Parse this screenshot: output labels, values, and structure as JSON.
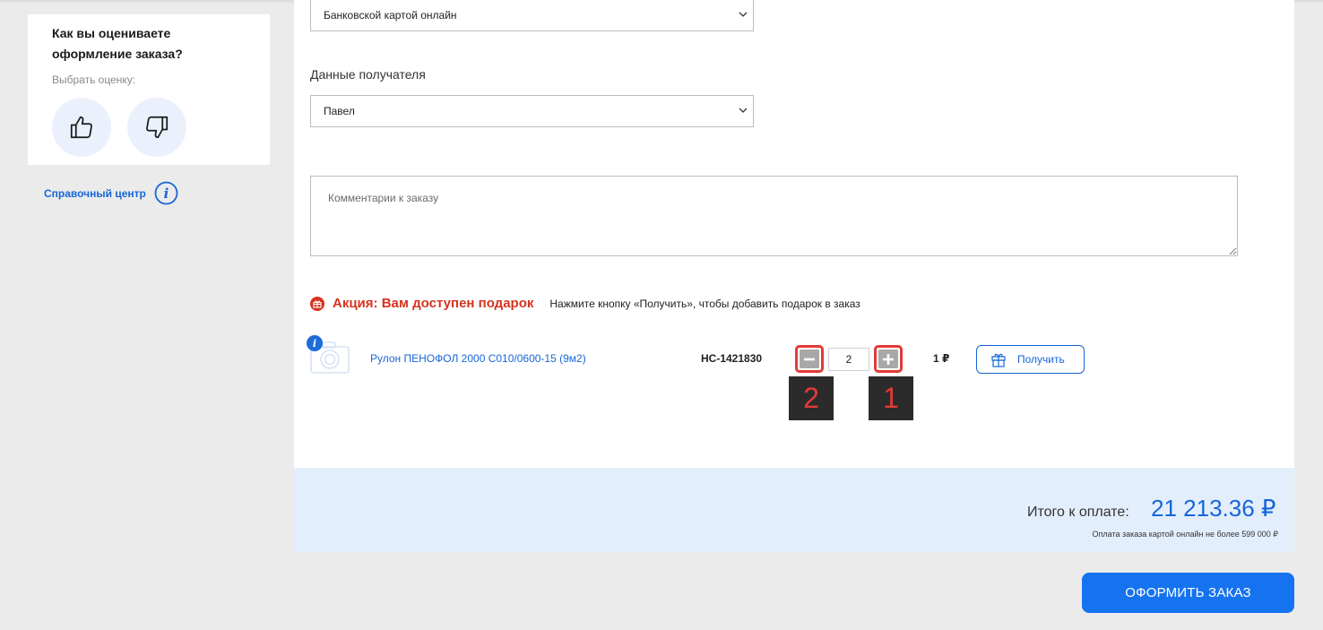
{
  "rating": {
    "title": "Как вы оцениваете оформление заказа?",
    "hint": "Выбрать оценку:"
  },
  "help": {
    "link_label": "Справочный центр"
  },
  "payment": {
    "selected": "Банковской картой онлайн"
  },
  "recipient": {
    "label": "Данные получателя",
    "selected": "Павел"
  },
  "comment": {
    "placeholder": "Комментарии к заказу"
  },
  "promo": {
    "title": "Акция: Вам доступен подарок",
    "text": "Нажмите кнопку «Получить», чтобы добавить подарок в заказ"
  },
  "gift_item": {
    "name": "Рулон ПЕНОФОЛ 2000 С010/0600-15 (9м2)",
    "code": "НС-1421830",
    "quantity": "2",
    "price": "1 ₽",
    "get_label": "Получить",
    "info_badge": "i"
  },
  "callouts": {
    "minus": "2",
    "plus": "1"
  },
  "totals": {
    "label": "Итого к оплате:",
    "value": "21 213.36 ₽",
    "note": "Оплата заказа картой онлайн не более 599 000 ₽"
  },
  "submit": {
    "label": "ОФОРМИТЬ ЗАКАЗ"
  },
  "colors": {
    "accent": "#1673f0",
    "link": "#1666d8",
    "promo": "#d6331f",
    "callout_border": "#e23a36",
    "totals_bg": "#e3eefc"
  }
}
